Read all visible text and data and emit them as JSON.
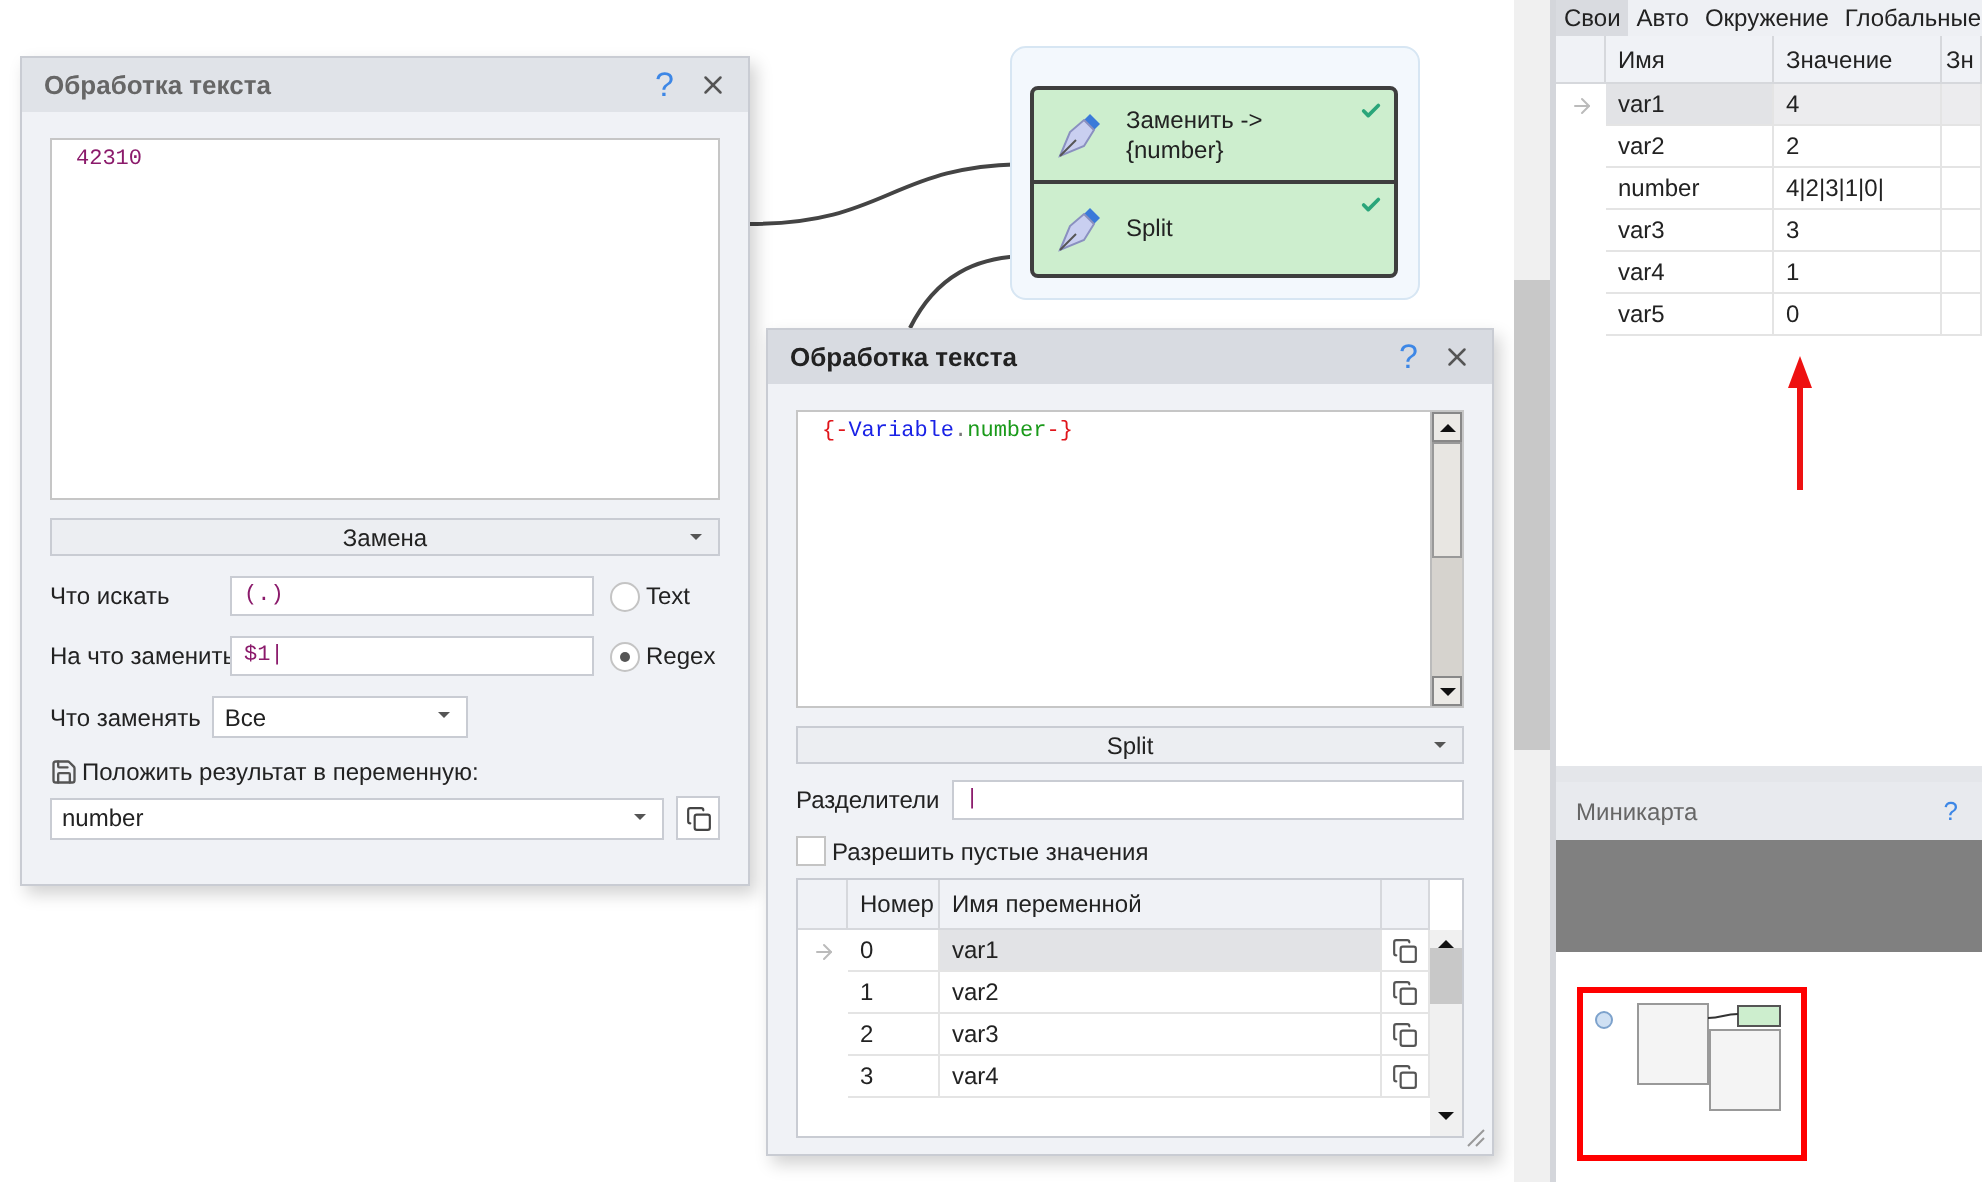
{
  "canvas": {
    "nodes": [
      {
        "label": "Заменить ->\n{number}",
        "done": true
      },
      {
        "label": "Split",
        "done": true
      }
    ],
    "replace_dialog": {
      "title": "Обработка текста",
      "help": "?",
      "active": false,
      "text": "42310",
      "mode": "Замена",
      "fields": [
        {
          "label": "Что искать",
          "value": "(.)"
        },
        {
          "label": "На что заменить",
          "value": "$1|"
        }
      ],
      "radios": [
        {
          "label": "Text",
          "selected": false
        },
        {
          "label": "Regex",
          "selected": true
        }
      ],
      "replace_which": {
        "label": "Что заменять",
        "value": "Все"
      },
      "result": {
        "label": "Положить результат в переменную:",
        "value": "number"
      }
    },
    "split_dialog": {
      "title": "Обработка текста",
      "help": "?",
      "active": true,
      "tokens": [
        {
          "text": "{-",
          "kind": "delimiter"
        },
        {
          "text": "Variable",
          "kind": "object"
        },
        {
          "text": ".",
          "kind": "dot"
        },
        {
          "text": "number",
          "kind": "property"
        },
        {
          "text": "-}",
          "kind": "delimiter"
        }
      ],
      "mode": "Split",
      "separator": {
        "label": "Разделители",
        "value": "|"
      },
      "allow_empty": {
        "label": "Разрешить пустые значения",
        "checked": false
      },
      "columns": [
        "Номер",
        "Имя переменной"
      ],
      "rows": [
        {
          "index": "0",
          "name": "var1",
          "selected": true
        },
        {
          "index": "1",
          "name": "var2",
          "selected": false
        },
        {
          "index": "2",
          "name": "var3",
          "selected": false
        },
        {
          "index": "3",
          "name": "var4",
          "selected": false
        }
      ]
    }
  },
  "variables_panel": {
    "tabs": [
      {
        "label": "Свои",
        "selected": true
      },
      {
        "label": "Авто",
        "selected": false
      },
      {
        "label": "Окружение",
        "selected": false
      },
      {
        "label": "Глобальные",
        "selected": false
      }
    ],
    "columns": [
      "Имя",
      "Значение",
      "Зн"
    ],
    "rows": [
      {
        "name": "var1",
        "value": "4",
        "selected": true
      },
      {
        "name": "var2",
        "value": "2",
        "selected": false
      },
      {
        "name": "number",
        "value": "4|2|3|1|0|",
        "selected": false
      },
      {
        "name": "var3",
        "value": "3",
        "selected": false
      },
      {
        "name": "var4",
        "value": "1",
        "selected": false
      },
      {
        "name": "var5",
        "value": "0",
        "selected": false
      }
    ]
  },
  "minimap": {
    "title": "Миникарта",
    "help": "?"
  }
}
